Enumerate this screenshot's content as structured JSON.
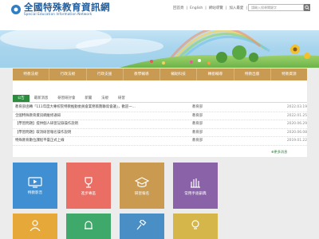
{
  "header": {
    "logo_title": "全國特殊教育資訊網",
    "logo_subtitle": "Special Education Information Network",
    "toplinks": [
      "回首頁",
      "English",
      "網站導覽",
      "加入最愛",
      "手機瀏覽"
    ],
    "search_placeholder": "請輸入搜尋關鍵字"
  },
  "nav": [
    "特教法規",
    "行政法規",
    "行政支援",
    "教學輔導",
    "輔助科技",
    "轉銜輔導",
    "特教出版",
    "特教資源"
  ],
  "tabs": [
    "公告",
    "最新消息",
    "研習研討會",
    "新聞",
    "法規",
    "研習"
  ],
  "news": [
    {
      "title": "教育部函轉「111年度大專校院特教推動委員會業務策劃聯席會議」，歡迎一...",
      "unit": "教育部",
      "date": "2022.03.19"
    },
    {
      "title": "全國特殊教育資訊網維修通知",
      "unit": "教育部",
      "date": "2022.01.25"
    },
    {
      "title": "【學習問題】提供個人研習記錄操作說明",
      "unit": "教育部",
      "date": "2020.06.29"
    },
    {
      "title": "【學習問題】取消研習報名操作說明",
      "unit": "教育部",
      "date": "2020.06.08"
    },
    {
      "title": "特殊教育數位課程平臺正式上線",
      "unit": "教育部",
      "date": "2019.01.22"
    }
  ],
  "more_label": "更多消息",
  "tiles": [
    {
      "label": "特教影音",
      "color": "#3f8fd2",
      "icon": "monitor-icon"
    },
    {
      "label": "進步專區",
      "color": "#ea6e63",
      "icon": "trophy-icon"
    },
    {
      "label": "研習報名",
      "color": "#c99a4f",
      "icon": "graduation-cap-icon"
    },
    {
      "label": "常用手語辭典",
      "color": "#8a62a8",
      "icon": "sign-language-hand-icon"
    },
    {
      "label": "",
      "color": "#e7a83a",
      "icon": "person-icon"
    },
    {
      "label": "",
      "color": "#3fa86b",
      "icon": "bell-icon"
    },
    {
      "label": "",
      "color": "#4a8ec6",
      "icon": "gavel-icon"
    },
    {
      "label": "",
      "color": "#d5b64a",
      "icon": "lightbulb-icon"
    }
  ]
}
